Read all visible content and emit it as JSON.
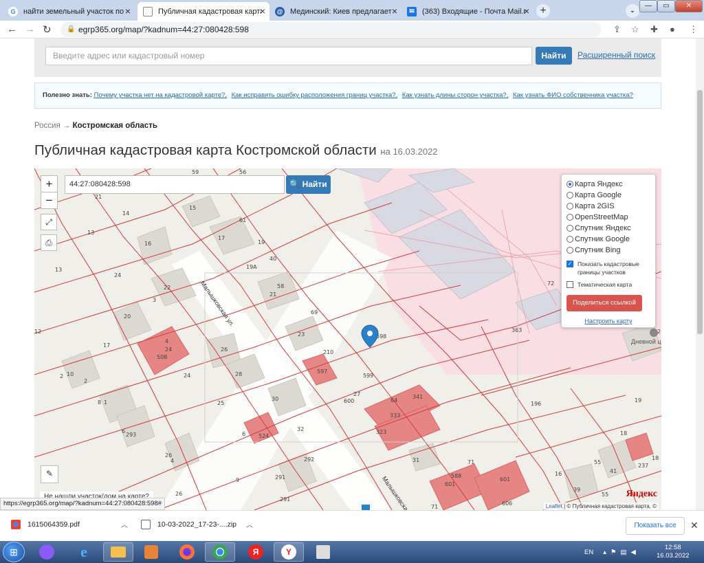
{
  "tabs": [
    {
      "title": "найти земельный участок по ка",
      "favicon": "google-icon",
      "color": "#4285f4",
      "glyph": "G"
    },
    {
      "title": "Публичная кадастровая карта К",
      "favicon": "page-icon",
      "color": "#1a73e8",
      "glyph": "▢"
    },
    {
      "title": "Мединский: Киев предлагает ас",
      "favicon": "news-icon",
      "color": "#2a5db0",
      "glyph": "@"
    },
    {
      "title": "(363) Входящие - Почта Mail.ru",
      "favicon": "mail-icon",
      "color": "#1a73e8",
      "glyph": "✉"
    }
  ],
  "browser": {
    "url": "egrp365.org/map/?kadnum=44:27:080428:598",
    "status_url": "https://egrp365.org/map/?kadnum=44:27:080428:598#"
  },
  "site": {
    "search_placeholder": "Введите адрес или кадастровый номер",
    "find_label": "Найти",
    "advanced_search": "Расширенный поиск",
    "hint_label": "Полезно знать:",
    "hint_links": [
      "Почему участка нет на кадастровой карте?,",
      "Как исправить ошибку расположения границ участка?,",
      "Как узнать длины сторон участка?,",
      "Как узнать ФИО собственника участка?"
    ],
    "breadcrumb_root": "Россия",
    "breadcrumb_arrow": "→",
    "breadcrumb_current": "Костромская область",
    "title": "Публичная кадастровая карта Костромской области",
    "title_date": "на 16.03.2022"
  },
  "map": {
    "zoom_in": "+",
    "zoom_out": "−",
    "cadastral_value": "44:27:080428:598",
    "find_label": "Найти",
    "layers": [
      {
        "label": "Карта Яндекс",
        "selected": true
      },
      {
        "label": "Карта Google",
        "selected": false
      },
      {
        "label": "Карта 2GIS",
        "selected": false
      },
      {
        "label": "OpenStreetMap",
        "selected": false
      },
      {
        "label": "Спутник Яндекс",
        "selected": false
      },
      {
        "label": "Спутник Google",
        "selected": false
      },
      {
        "label": "Спутник Bing",
        "selected": false
      }
    ],
    "show_borders": "Показать кадастровые границы участков",
    "show_borders_checked": true,
    "thematic": "Тематическая карта",
    "thematic_checked": false,
    "share_label": "Поделиться ссылкой",
    "configure_label": "Настроить карту",
    "not_found": "Не нашли участок/дом на карте?",
    "street_label_1": "Малышковская ул.",
    "street_label_2": "Малышковская",
    "poi_label": "Дневной ц",
    "attribution_leaflet": "Leaflet",
    "attribution_rest": "| © Публичная кадастровая карта, ©",
    "yandex_logo": "Яндекс",
    "parcel_numbers": [
      "21",
      "14",
      "15",
      "61",
      "17",
      "19",
      "13",
      "16",
      "40",
      "19А",
      "13",
      "24",
      "22",
      "58",
      "21",
      "3",
      "69",
      "20",
      "4",
      "24",
      "508",
      "23",
      "210",
      "598",
      "12",
      "17",
      "26",
      "597",
      "599",
      "2",
      "10",
      "2",
      "24",
      "28",
      "27",
      "8",
      "1",
      "600",
      "64",
      "341",
      "25",
      "30",
      "323",
      "333",
      "6",
      "293",
      "6",
      "524",
      "32",
      "292",
      "31",
      "26",
      "4",
      "9",
      "291",
      "291",
      "26",
      "71",
      "601",
      "588",
      "601",
      "606",
      "71",
      "363",
      "196",
      "19",
      "18",
      "237",
      "18",
      "55",
      "41",
      "16",
      "39",
      "55",
      "56",
      "59",
      "72",
      "2"
    ]
  },
  "downloads": [
    {
      "name": "1615064359.pdf",
      "icon": "chrome-icon"
    },
    {
      "name": "10-03-2022_17-23-....zip",
      "icon": "file-icon"
    }
  ],
  "downloads_show_all": "Показать все",
  "taskbar": {
    "lang": "EN",
    "time": "12:58",
    "date": "16.03.2022",
    "apps": [
      "Я",
      "Y"
    ]
  }
}
